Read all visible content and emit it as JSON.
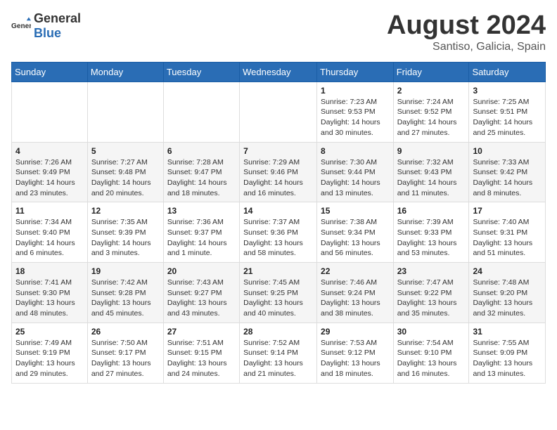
{
  "header": {
    "logo_general": "General",
    "logo_blue": "Blue",
    "month_year": "August 2024",
    "location": "Santiso, Galicia, Spain"
  },
  "weekdays": [
    "Sunday",
    "Monday",
    "Tuesday",
    "Wednesday",
    "Thursday",
    "Friday",
    "Saturday"
  ],
  "weeks": [
    [
      {
        "day": "",
        "content": ""
      },
      {
        "day": "",
        "content": ""
      },
      {
        "day": "",
        "content": ""
      },
      {
        "day": "",
        "content": ""
      },
      {
        "day": "1",
        "content": "Sunrise: 7:23 AM\nSunset: 9:53 PM\nDaylight: 14 hours and 30 minutes."
      },
      {
        "day": "2",
        "content": "Sunrise: 7:24 AM\nSunset: 9:52 PM\nDaylight: 14 hours and 27 minutes."
      },
      {
        "day": "3",
        "content": "Sunrise: 7:25 AM\nSunset: 9:51 PM\nDaylight: 14 hours and 25 minutes."
      }
    ],
    [
      {
        "day": "4",
        "content": "Sunrise: 7:26 AM\nSunset: 9:49 PM\nDaylight: 14 hours and 23 minutes."
      },
      {
        "day": "5",
        "content": "Sunrise: 7:27 AM\nSunset: 9:48 PM\nDaylight: 14 hours and 20 minutes."
      },
      {
        "day": "6",
        "content": "Sunrise: 7:28 AM\nSunset: 9:47 PM\nDaylight: 14 hours and 18 minutes."
      },
      {
        "day": "7",
        "content": "Sunrise: 7:29 AM\nSunset: 9:46 PM\nDaylight: 14 hours and 16 minutes."
      },
      {
        "day": "8",
        "content": "Sunrise: 7:30 AM\nSunset: 9:44 PM\nDaylight: 14 hours and 13 minutes."
      },
      {
        "day": "9",
        "content": "Sunrise: 7:32 AM\nSunset: 9:43 PM\nDaylight: 14 hours and 11 minutes."
      },
      {
        "day": "10",
        "content": "Sunrise: 7:33 AM\nSunset: 9:42 PM\nDaylight: 14 hours and 8 minutes."
      }
    ],
    [
      {
        "day": "11",
        "content": "Sunrise: 7:34 AM\nSunset: 9:40 PM\nDaylight: 14 hours and 6 minutes."
      },
      {
        "day": "12",
        "content": "Sunrise: 7:35 AM\nSunset: 9:39 PM\nDaylight: 14 hours and 3 minutes."
      },
      {
        "day": "13",
        "content": "Sunrise: 7:36 AM\nSunset: 9:37 PM\nDaylight: 14 hours and 1 minute."
      },
      {
        "day": "14",
        "content": "Sunrise: 7:37 AM\nSunset: 9:36 PM\nDaylight: 13 hours and 58 minutes."
      },
      {
        "day": "15",
        "content": "Sunrise: 7:38 AM\nSunset: 9:34 PM\nDaylight: 13 hours and 56 minutes."
      },
      {
        "day": "16",
        "content": "Sunrise: 7:39 AM\nSunset: 9:33 PM\nDaylight: 13 hours and 53 minutes."
      },
      {
        "day": "17",
        "content": "Sunrise: 7:40 AM\nSunset: 9:31 PM\nDaylight: 13 hours and 51 minutes."
      }
    ],
    [
      {
        "day": "18",
        "content": "Sunrise: 7:41 AM\nSunset: 9:30 PM\nDaylight: 13 hours and 48 minutes."
      },
      {
        "day": "19",
        "content": "Sunrise: 7:42 AM\nSunset: 9:28 PM\nDaylight: 13 hours and 45 minutes."
      },
      {
        "day": "20",
        "content": "Sunrise: 7:43 AM\nSunset: 9:27 PM\nDaylight: 13 hours and 43 minutes."
      },
      {
        "day": "21",
        "content": "Sunrise: 7:45 AM\nSunset: 9:25 PM\nDaylight: 13 hours and 40 minutes."
      },
      {
        "day": "22",
        "content": "Sunrise: 7:46 AM\nSunset: 9:24 PM\nDaylight: 13 hours and 38 minutes."
      },
      {
        "day": "23",
        "content": "Sunrise: 7:47 AM\nSunset: 9:22 PM\nDaylight: 13 hours and 35 minutes."
      },
      {
        "day": "24",
        "content": "Sunrise: 7:48 AM\nSunset: 9:20 PM\nDaylight: 13 hours and 32 minutes."
      }
    ],
    [
      {
        "day": "25",
        "content": "Sunrise: 7:49 AM\nSunset: 9:19 PM\nDaylight: 13 hours and 29 minutes."
      },
      {
        "day": "26",
        "content": "Sunrise: 7:50 AM\nSunset: 9:17 PM\nDaylight: 13 hours and 27 minutes."
      },
      {
        "day": "27",
        "content": "Sunrise: 7:51 AM\nSunset: 9:15 PM\nDaylight: 13 hours and 24 minutes."
      },
      {
        "day": "28",
        "content": "Sunrise: 7:52 AM\nSunset: 9:14 PM\nDaylight: 13 hours and 21 minutes."
      },
      {
        "day": "29",
        "content": "Sunrise: 7:53 AM\nSunset: 9:12 PM\nDaylight: 13 hours and 18 minutes."
      },
      {
        "day": "30",
        "content": "Sunrise: 7:54 AM\nSunset: 9:10 PM\nDaylight: 13 hours and 16 minutes."
      },
      {
        "day": "31",
        "content": "Sunrise: 7:55 AM\nSunset: 9:09 PM\nDaylight: 13 hours and 13 minutes."
      }
    ]
  ]
}
